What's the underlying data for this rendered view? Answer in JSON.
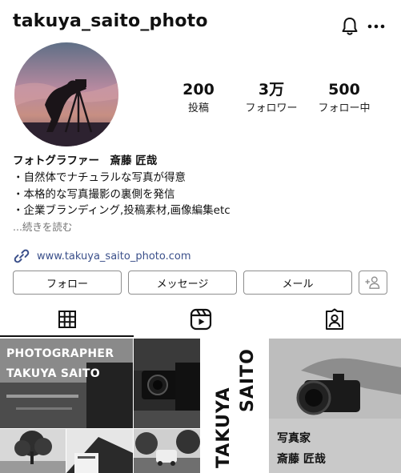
{
  "profile": {
    "username": "takuya_saito_photo",
    "stats": [
      {
        "value": "200",
        "label": "投稿"
      },
      {
        "value": "3万",
        "label": "フォロワー"
      },
      {
        "value": "500",
        "label": "フォロー中"
      }
    ],
    "bio_name": "フォトグラファー　斎藤 匠哉",
    "bio_lines": [
      "・自然体でナチュラルな写真が得意",
      "・本格的な写真撮影の裏側を発信",
      "・企業ブランディング,投稿素材,画像編集etc"
    ],
    "read_more": "...続きを読む",
    "website": "www.takuya_saito_photo.com"
  },
  "buttons": {
    "follow": "フォロー",
    "message": "メッセージ",
    "email": "メール"
  },
  "icons": {
    "bell": "bell-icon",
    "more": "more-icon",
    "link": "link-icon",
    "add_person": "add-person-icon",
    "grid": "grid-icon",
    "reels": "reels-icon",
    "tagged": "tagged-icon"
  },
  "grid": {
    "post1_line1": "PHOTOGRAPHER",
    "post1_line2": "TAKUYA SAITO",
    "post3_vertical_1": "TAKUYA",
    "post3_vertical_2": "SAITO",
    "post4_line1": "写真家",
    "post4_line2": "斎藤 匠哉"
  },
  "colors": {
    "link": "#3a4f8a",
    "muted": "#737373",
    "border": "#8e8e8e"
  }
}
